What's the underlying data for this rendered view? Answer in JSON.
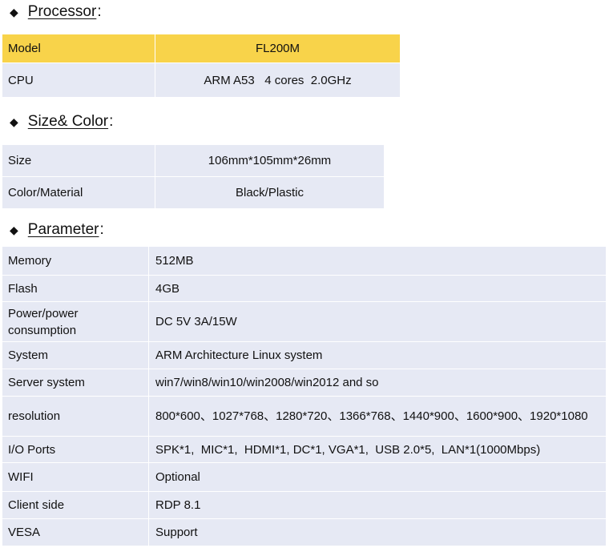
{
  "sections": {
    "processor": {
      "title": "Processor",
      "colon": ":"
    },
    "size_color": {
      "title": "Size& Color",
      "colon": ":"
    },
    "parameter": {
      "title": "Parameter",
      "colon": ":"
    }
  },
  "processor_table": [
    {
      "label": "Model",
      "value": "FL200M"
    },
    {
      "label": "CPU",
      "value": "ARM A53   4 cores  2.0GHz"
    }
  ],
  "size_table": [
    {
      "label": "Size",
      "value": "106mm*105mm*26mm"
    },
    {
      "label": "Color/Material",
      "value": "Black/Plastic"
    }
  ],
  "param_table": [
    {
      "label": "Memory",
      "value": "512MB"
    },
    {
      "label": "Flash",
      "value": "4GB"
    },
    {
      "label": "Power/power\nconsumption",
      "value": "DC 5V 3A/15W"
    },
    {
      "label": "System",
      "value": "ARM Architecture Linux system"
    },
    {
      "label": "Server system",
      "value": "win7/win8/win10/win2008/win2012 and so"
    },
    {
      "label": "resolution",
      "value": "800*600、1027*768、1280*720、1366*768、1440*900、1600*900、1920*1080"
    },
    {
      "label": "I/O Ports",
      "value": "SPK*1,  MIC*1,  HDMI*1, DC*1, VGA*1,  USB 2.0*5,  LAN*1(1000Mbps)"
    },
    {
      "label": "WIFI",
      "value": "Optional"
    },
    {
      "label": "Client side",
      "value": "RDP 8.1"
    },
    {
      "label": "VESA",
      "value": "Support"
    }
  ],
  "colors": {
    "highlight": "#f8d34a",
    "row_bg": "#e6e9f4"
  }
}
